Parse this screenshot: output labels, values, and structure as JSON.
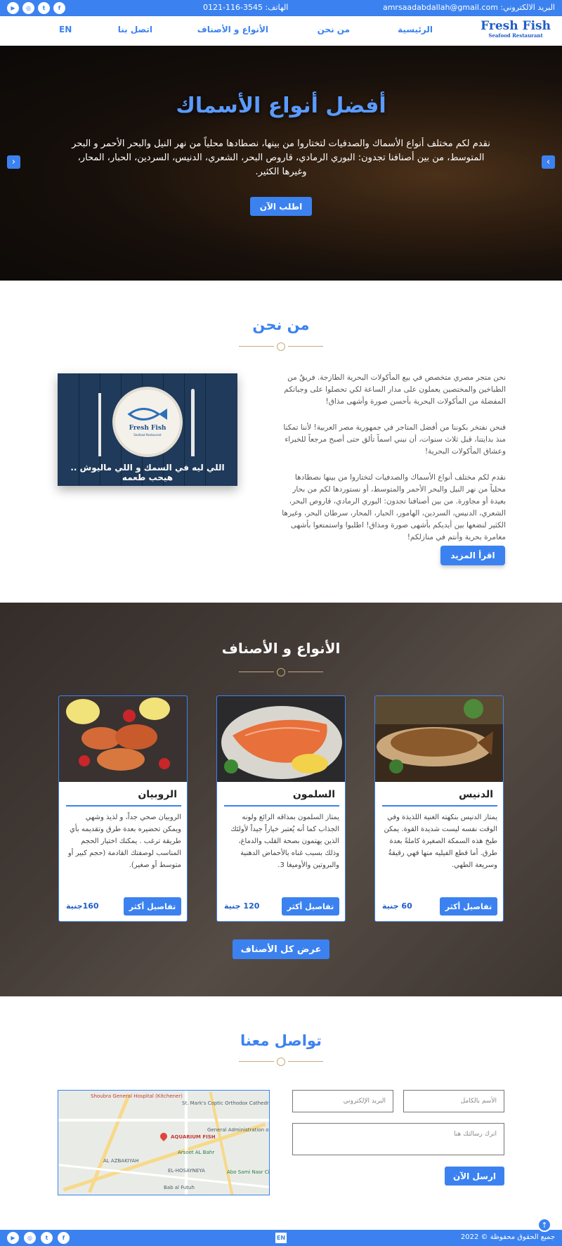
{
  "topbar": {
    "email": "البريد الالكتروني: amrsaadabdallah@gmail.com",
    "phone": "الهاتف: 3545-116-0121",
    "social": [
      {
        "icon": "facebook-icon",
        "glyph": "f"
      },
      {
        "icon": "twitter-icon",
        "glyph": "t"
      },
      {
        "icon": "instagram-icon",
        "glyph": "◎"
      },
      {
        "icon": "youtube-icon",
        "glyph": "▶"
      }
    ]
  },
  "brand": {
    "name": "Fresh Fish",
    "tagline": "Seafood Restaurant"
  },
  "nav": {
    "home": "الرئيسية",
    "about": "من نحن",
    "types": "الأنواع و الأصناف",
    "contact": "اتصل بنا",
    "lang": "EN"
  },
  "hero": {
    "title": "أفضل أنواع الأسماك",
    "text": "نقدم لكم مختلف أنواع الأسماك والصدفيات لتختاروا من بينها، نصطادها محلياً من نهر النيل والبحر الأحمر و البحر المتوسط، من بين أصنافنا تجدون: البوري الرمادي، قاروص البحر، الشعري، الدنيس، السردين، الحبار، المحار، وغيرها الكثير.",
    "button": "اطلب الآن",
    "prev": "‹",
    "next": "›"
  },
  "about": {
    "title": "من نحن",
    "p1": "نحن متجر مصري متخصص في بيع المأكولات البحرية الطازجة. فريقٌ من الطباخين والمختصين يعملون على مدار الساعة لكي تحصلوا على وجباتكم المفضلة من المأكولات البحرية بأحسن صورة وأشهى مذاق!",
    "p2": "فنحن نفتخر بكوننا من أفضل المتاجر في جمهورية مصر العربية! لأننا تمكنا منذ بدايتنا، قبل ثلاث سنوات، أن نبني اسماً تألق حتى أصبح مرجعاً للخبراء وعشاق المأكولات البحرية!",
    "p3": "نقدم لكم مختلف أنواع الأسماك والصدفيات لتختاروا من بينها نصطادها محلياً من نهر النيل والبحر الأحمر والمتوسط، أو نستوردها لكم من بحار بعيدة أو مجاورة. من بين أصنافنا تجدون: البوري الرمادي، قاروص البحر، الشعري، الدنيس، السردين، الهامور، الحبار، المحار، سرطان البحر، وغيرها الكثير لنضعها بين أيديكم بأشهى صورة ومذاق! اطلبوا واستمتعوا بأشهى مغامرة بحرية وأنتم في منازلكم!",
    "button": "اقرأ المزيد",
    "image_caption": "اللي ليه في السمك و اللي ماليوش .. هيحب طعمه",
    "image_brand": "Fresh Fish",
    "image_tagline": "Seafood Restaurant"
  },
  "types": {
    "title": "الأنواع و الأصناف",
    "cards": [
      {
        "name": "الدنيس",
        "desc": "يمتاز الدنيس بنكهته الغنية اللذيذة وفي الوقت نفسه ليست شديدة القوة. يمكن طبخ هذه السمكة الصغيرة كاملةً بعدة طرق. أما قطع الفيليه منها فهي رقيقةٌ وسريعة الطهي.",
        "button": "تفاصيل أكثر",
        "price": "60 جنية"
      },
      {
        "name": "السلمون",
        "desc": "يمتاز السلمون بمذاقه الرائع ولونه الجذاب كما أنه يُعتبر خياراً جيداً لأولئك الذين يهتمون بصحة القلب والدماغ، وذلك بسبب غناه بالأحماض الدهنية والبروتين والأوميغا 3.",
        "button": "تفاصيل أكثر",
        "price": "120 جنية"
      },
      {
        "name": "الروبيان",
        "desc": "الروبيان صحي جداً، و لذيذ وشهي ويمكن تحضيره بعدة طرق وتقديمه بأي طريقة ترغب . يمكنك اختيار الحجم المناسب لوصفتك القادمة (حجم كبير أو متوسط أو صغير).",
        "button": "تفاصيل أكثر",
        "price": "160جنية"
      }
    ],
    "show_all": "عرض كل الأصناف"
  },
  "contact": {
    "title": "تواصل معنا",
    "name_placeholder": "الأسم بالكامل",
    "email_placeholder": "البريد الإلكتروني",
    "message_placeholder": "اترك رسالتك هنا",
    "button": "ارسل الآن",
    "map_labels": {
      "hospital": "Shoubra General Hospital (Kitchener)",
      "cathedral": "St. Mark's Coptic Orthodox Cathedral",
      "shop": "AQUARIUM FISH",
      "admin": "General Administration of Passports",
      "arsoet": "Arsoet AL Bahr",
      "azbakiyah": "AL AZBAKIYAH",
      "husayneya": "EL-HOSAYNEYA",
      "sami": "Abo Sami Nasr City",
      "futuh": "Bab al Futuh"
    }
  },
  "footer": {
    "copyright": "جميع الحقوق محفوظة © 2022",
    "lang": "EN",
    "to_top": "↑"
  },
  "colors": {
    "accent": "#3b82f0",
    "brand": "#1e5dc8"
  }
}
